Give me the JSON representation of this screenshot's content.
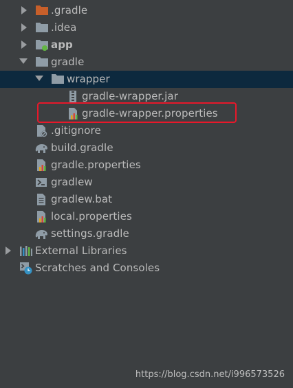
{
  "tree": {
    "items": [
      {
        "label": ".gradle",
        "icon": "folder-orange-icon"
      },
      {
        "label": ".idea",
        "icon": "folder-icon"
      },
      {
        "label": "app",
        "icon": "module-folder-icon"
      },
      {
        "label": "gradle",
        "icon": "folder-icon"
      },
      {
        "label": "wrapper",
        "icon": "folder-icon"
      },
      {
        "label": "gradle-wrapper.jar",
        "icon": "jar-file-icon"
      },
      {
        "label": "gradle-wrapper.properties",
        "icon": "properties-file-icon"
      },
      {
        "label": ".gitignore",
        "icon": "gitignore-file-icon"
      },
      {
        "label": "build.gradle",
        "icon": "gradle-elephant-icon"
      },
      {
        "label": "gradle.properties",
        "icon": "properties-file-icon"
      },
      {
        "label": "gradlew",
        "icon": "terminal-file-icon"
      },
      {
        "label": "gradlew.bat",
        "icon": "text-file-icon"
      },
      {
        "label": "local.properties",
        "icon": "properties-file-icon"
      },
      {
        "label": "settings.gradle",
        "icon": "gradle-elephant-icon"
      },
      {
        "label": "External Libraries",
        "icon": "libraries-icon"
      },
      {
        "label": "Scratches and Consoles",
        "icon": "scratches-icon"
      }
    ]
  },
  "colors": {
    "background": "#3c3f41",
    "selection": "#0d293e",
    "highlight_border": "#e8182a",
    "text": "#bbbbbb"
  },
  "watermark": "https://blog.csdn.net/i996573526"
}
